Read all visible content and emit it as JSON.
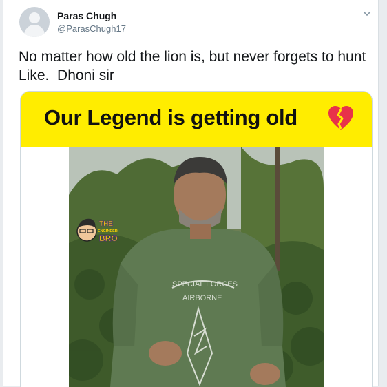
{
  "user": {
    "name": "Paras Chugh",
    "handle": "@ParasChugh17"
  },
  "tweet": {
    "lines": [
      "No matter how old the lion is, but never forgets to hunt",
      "Like.  Dhoni sir"
    ]
  },
  "media": {
    "banner_text": "Our Legend is getting old",
    "banner_icon": "broken-heart-icon",
    "watermark": {
      "line1": "THE",
      "line2": "ENGINEER",
      "line3": "BRO"
    },
    "shirt_text": {
      "line1": "SPECIAL FORCES",
      "line2": "AIRBORNE"
    }
  },
  "colors": {
    "banner": "#ffed00",
    "heart": "#e8324a",
    "name": "#14171a",
    "handle": "#657786"
  }
}
